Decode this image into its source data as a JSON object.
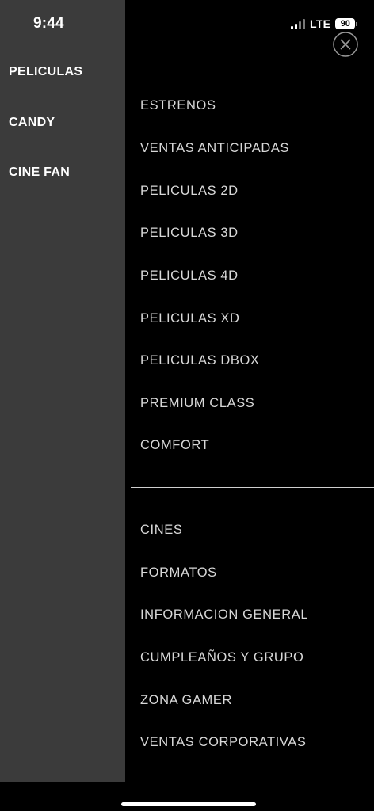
{
  "status_bar": {
    "time": "9:44",
    "network": "LTE",
    "battery": "90",
    "signal_icon": "signal-bars-icon",
    "battery_icon": "battery-icon"
  },
  "categories": [
    {
      "label": "PELICULAS"
    },
    {
      "label": "CANDY"
    },
    {
      "label": "CINE FAN"
    }
  ],
  "close_icon": "close-icon",
  "menu_primary": [
    {
      "label": "ESTRENOS"
    },
    {
      "label": "VENTAS ANTICIPADAS"
    },
    {
      "label": "PELICULAS 2D"
    },
    {
      "label": "PELICULAS 3D"
    },
    {
      "label": "PELICULAS 4D"
    },
    {
      "label": "PELICULAS XD"
    },
    {
      "label": "PELICULAS DBOX"
    },
    {
      "label": "PREMIUM CLASS"
    },
    {
      "label": "COMFORT"
    }
  ],
  "menu_secondary": [
    {
      "label": "CINES"
    },
    {
      "label": "FORMATOS"
    },
    {
      "label": "INFORMACION GENERAL"
    },
    {
      "label": "CUMPLEAÑOS Y GRUPO"
    },
    {
      "label": "ZONA GAMER"
    },
    {
      "label": "VENTAS CORPORATIVAS"
    }
  ],
  "colors": {
    "background": "#000000",
    "left_panel": "#3b3b3b",
    "menu_text": "#d8d8d8",
    "category_text": "#ffffff"
  }
}
